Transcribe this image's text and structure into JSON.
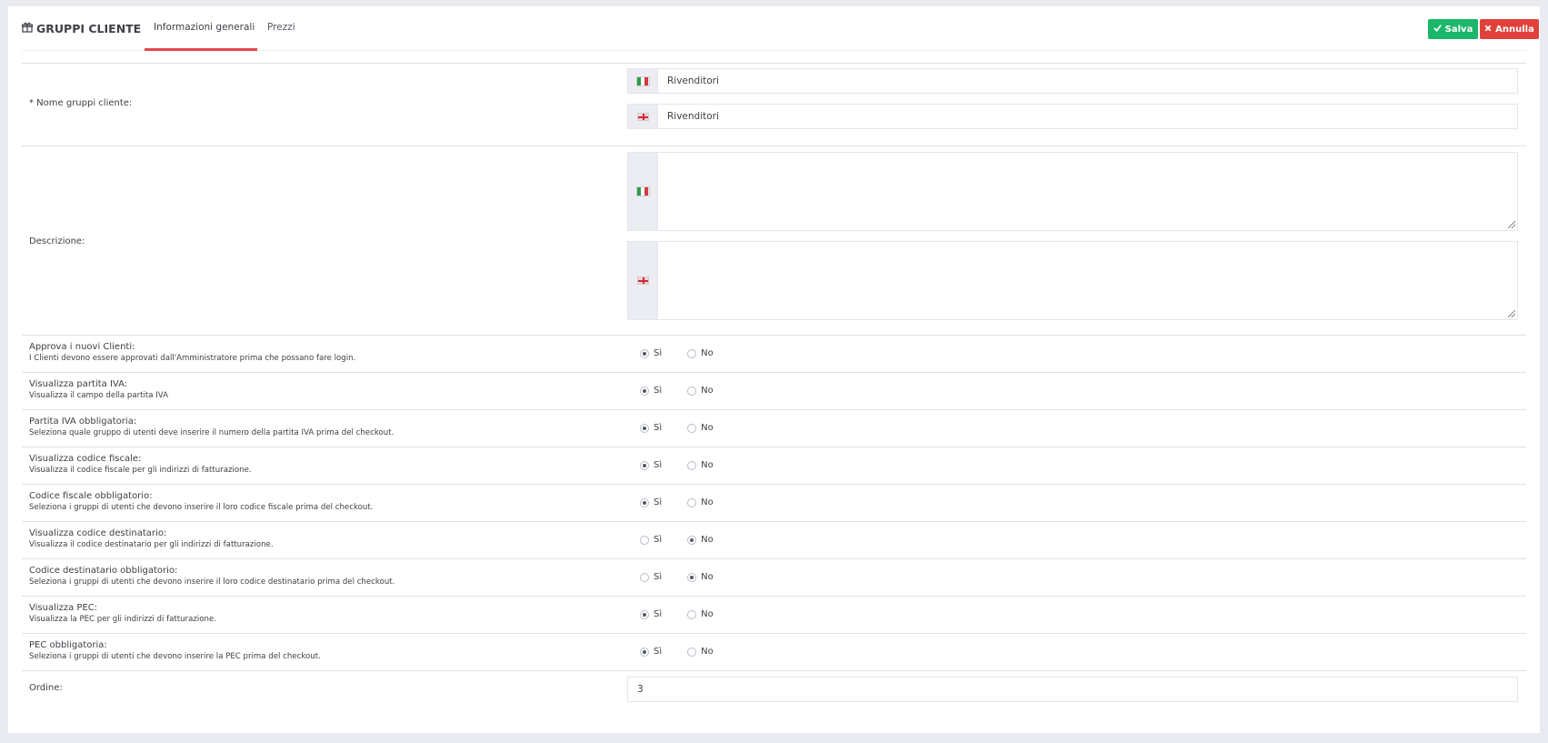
{
  "header": {
    "title": "GRUPPI CLIENTE",
    "title_icon": "gift-icon",
    "tabs": [
      {
        "label": "Informazioni generali",
        "active": true
      },
      {
        "label": "Prezzi",
        "active": false
      }
    ],
    "save_label": "Salva",
    "cancel_label": "Annulla",
    "save_color": "#1cb76a",
    "cancel_color": "#e0413a",
    "tab_accent": "#e5484d"
  },
  "name_section": {
    "label": "* Nome gruppi cliente:",
    "values": [
      {
        "lang": "italian-flag-icon",
        "value": "Rivenditori"
      },
      {
        "lang": "english-flag-icon",
        "value": "Rivenditori"
      }
    ]
  },
  "description_section": {
    "label": "Descrizione:",
    "values": [
      {
        "lang": "italian-flag-icon",
        "value": ""
      },
      {
        "lang": "english-flag-icon",
        "value": ""
      }
    ]
  },
  "options": [
    {
      "label": "Approva i nuovi Clienti:",
      "desc": "I Clienti devono essere approvati dall'Amministratore prima che possano fare login.",
      "yes": "Sì",
      "no": "No",
      "selected": "yes"
    },
    {
      "label": "Visualizza partita IVA:",
      "desc": "Visualizza il campo della partita IVA",
      "yes": "Sì",
      "no": "No",
      "selected": "yes"
    },
    {
      "label": "Partita IVA obbligatoria:",
      "desc": "Seleziona quale gruppo di utenti deve inserire il numero della partita IVA prima del checkout.",
      "yes": "Sì",
      "no": "No",
      "selected": "yes"
    },
    {
      "label": "Visualizza codice fiscale:",
      "desc": "Visualizza il codice fiscale per gli indirizzi di fatturazione.",
      "yes": "Sì",
      "no": "No",
      "selected": "yes"
    },
    {
      "label": "Codice fiscale obbligatorio:",
      "desc": "Seleziona i gruppi di utenti che devono inserire il loro codice fiscale prima del checkout.",
      "yes": "Sì",
      "no": "No",
      "selected": "yes"
    },
    {
      "label": "Visualizza codice destinatario:",
      "desc": "Visualizza il codice destinatario per gli indirizzi di fatturazione.",
      "yes": "Sì",
      "no": "No",
      "selected": "no"
    },
    {
      "label": "Codice destinatario obbligatorio:",
      "desc": "Seleziona i gruppi di utenti che devono inserire il loro codice destinatario prima del checkout.",
      "yes": "Sì",
      "no": "No",
      "selected": "no"
    },
    {
      "label": "Visualizza PEC:",
      "desc": "Visualizza la PEC per gli indirizzi di fatturazione.",
      "yes": "Sì",
      "no": "No",
      "selected": "yes"
    },
    {
      "label": "PEC obbligatoria:",
      "desc": "Seleziona i gruppi di utenti che devono inserire la PEC prima del checkout.",
      "yes": "Sì",
      "no": "No",
      "selected": "yes"
    }
  ],
  "order": {
    "label": "Ordine:",
    "value": "3"
  }
}
